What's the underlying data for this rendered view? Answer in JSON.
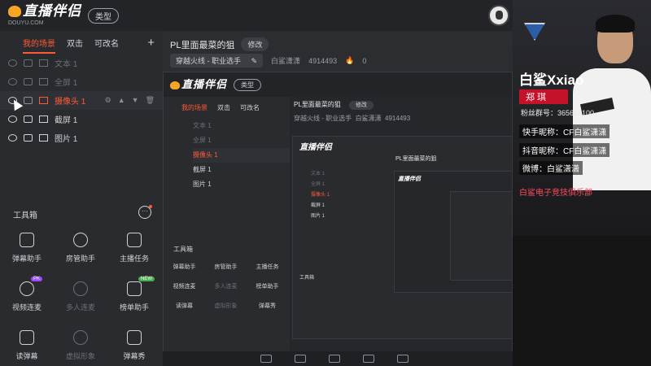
{
  "app": {
    "brand": "直播伴侣",
    "brand_sub": "DOUYU.COM",
    "type_label": "类型"
  },
  "scene_tabs": {
    "items": [
      "我的场景",
      "双击",
      "可改名"
    ],
    "add": "+"
  },
  "sources": [
    {
      "label": "文本 1",
      "state": "dim"
    },
    {
      "label": "全屏 1",
      "state": "dim"
    },
    {
      "label": "摄像头 1",
      "state": "selected"
    },
    {
      "label": "截屏 1",
      "state": "normal"
    },
    {
      "label": "图片 1",
      "state": "normal"
    }
  ],
  "toolbox": {
    "title": "工具箱",
    "more": "···",
    "tools": [
      {
        "label": "弹幕助手",
        "icon": "danmu-icon",
        "disabled": false
      },
      {
        "label": "房管助手",
        "icon": "admin-icon",
        "disabled": false
      },
      {
        "label": "主播任务",
        "icon": "task-icon",
        "disabled": false
      },
      {
        "label": "视频连麦",
        "icon": "video-link-icon",
        "disabled": false,
        "badge": "PK"
      },
      {
        "label": "多人连麦",
        "icon": "multi-link-icon",
        "disabled": true
      },
      {
        "label": "榜单助手",
        "icon": "rank-icon",
        "disabled": false,
        "badge": "NEW"
      },
      {
        "label": "读弹幕",
        "icon": "read-danmu-icon",
        "disabled": false
      },
      {
        "label": "虚拟形象",
        "icon": "avatar-icon",
        "disabled": true
      },
      {
        "label": "弹幕秀",
        "icon": "danmu-show-icon",
        "disabled": false
      }
    ]
  },
  "room": {
    "title": "PL里面最菜的狙",
    "edit_label": "修改",
    "category": "穿越火线 - 职业选手",
    "host": "白鲨潇潇",
    "room_id": "4914493",
    "fire_count": "0"
  },
  "streamer": {
    "name_en": "白鲨Xxiao",
    "name_cn": "郑 琪",
    "fan_group": "粉丝群号：365618100",
    "kuaishou": "快手昵称：CF白鲨潇潇",
    "douyin": "抖音昵称：CF白鲨潇潇",
    "weibo": "微博：白鲨潇潇",
    "club": "白鲨电子竞技俱乐部"
  }
}
